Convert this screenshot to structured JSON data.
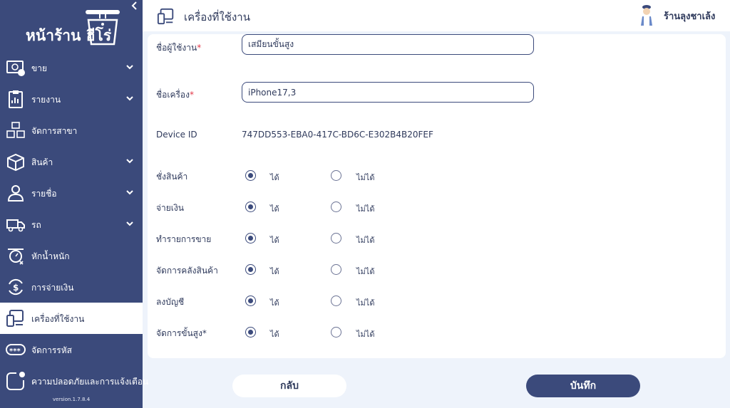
{
  "sidebar": {
    "logo_text": "หน้าร้าน ฮีโร่",
    "collapse_icon": "chevron-left-icon",
    "items": [
      {
        "label": "ขาย",
        "icon": "cash-icon",
        "has_chevron": true
      },
      {
        "label": "รายงาน",
        "icon": "clipboard-icon",
        "has_chevron": true
      },
      {
        "label": "จัดการสาขา",
        "icon": "branch-icon",
        "has_chevron": false
      },
      {
        "label": "สินค้า",
        "icon": "box-icon",
        "has_chevron": true
      },
      {
        "label": "รายชื่อ",
        "icon": "user-icon",
        "has_chevron": true
      },
      {
        "label": "รถ",
        "icon": "truck-icon",
        "has_chevron": true
      },
      {
        "label": "หักน้ำหนัก",
        "icon": "scale-icon",
        "has_chevron": false
      },
      {
        "label": "การจ่ายเงิน",
        "icon": "money-cycle-icon",
        "has_chevron": false
      },
      {
        "label": "เครื่องที่ใช้งาน",
        "icon": "devices-icon",
        "has_chevron": false,
        "active": true
      },
      {
        "label": "จัดการรหัส",
        "icon": "password-icon",
        "has_chevron": false
      },
      {
        "label": "ความปลอดภัยและการแจ้งเตือน",
        "icon": "notification-icon",
        "has_chevron": false
      }
    ],
    "version": "version.1.7.8.4"
  },
  "header": {
    "title": "เครื่องที่ใช้งาน",
    "shop_name": "ร้านลุงชาเล้ง"
  },
  "form": {
    "username_label": "ชื่อผู้ใช้งาน",
    "username_value": "เสมียนขั้นสูง",
    "device_name_label": "ชื่อเครื่อง",
    "device_name_value": "iPhone17,3",
    "required_mark": "*",
    "device_id_label": "Device ID",
    "device_id_value": "747DD553-EBA0-417C-BD6C-E302B4B20FEF",
    "allow_label": "ได้",
    "deny_label": "ไม่ได้",
    "permissions": [
      {
        "label": "ชั่งสินค้า",
        "allowed": true
      },
      {
        "label": "จ่ายเงิน",
        "allowed": true
      },
      {
        "label": "ทำรายการขาย",
        "allowed": true
      },
      {
        "label": "จัดการคลังสินค้า",
        "allowed": true
      },
      {
        "label": "ลงบัญชี",
        "allowed": true
      },
      {
        "label": "จัดการขั้นสูง*",
        "allowed": true
      }
    ]
  },
  "buttons": {
    "back": "กลับ",
    "save": "บันทึก"
  },
  "colors": {
    "sidebar": "#3b4a7b",
    "background": "#eef3fb",
    "required": "#e23a4a"
  }
}
